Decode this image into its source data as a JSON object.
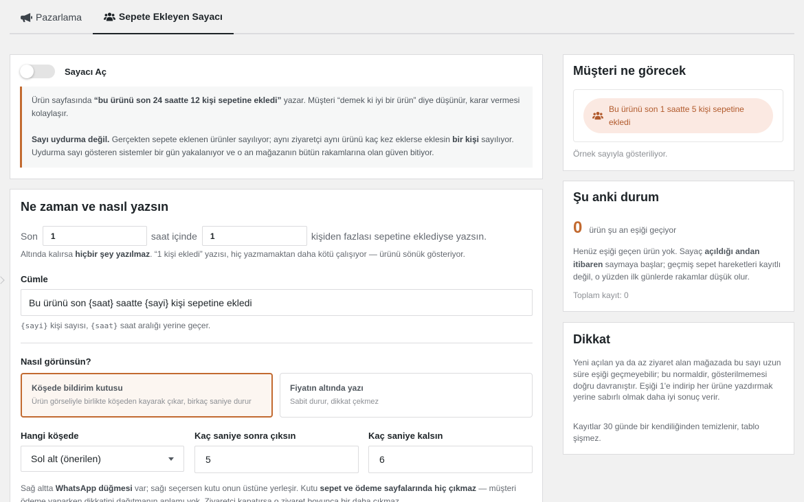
{
  "tabs": [
    {
      "label": "Pazarlama",
      "icon": "bullhorn-icon",
      "active": false
    },
    {
      "label": "Sepete Ekleyen Sayacı",
      "icon": "users-icon",
      "active": true
    }
  ],
  "toggle_card": {
    "toggle_label": "Sayacı Aç",
    "toggle_on": false,
    "info": {
      "p1_a": "Ürün sayfasında ",
      "p1_b": "“bu ürünü son 24 saatte 12 kişi sepetine ekledi”",
      "p1_c": " yazar. Müşteri “demek ki iyi bir ürün” diye düşünür, karar vermesi kolaylaşır.",
      "p2_a": "Sayı uydurma değil.",
      "p2_b": " Gerçekten sepete eklenen ürünler sayılıyor; aynı ziyaretçi aynı ürünü kaç kez eklerse eklesin ",
      "p2_c": "bir kişi",
      "p2_d": " sayılıyor. Uydurma sayı gösteren sistemler bir gün yakalanıyor ve o an mağazanın bütün rakamlarına olan güven bitiyor."
    }
  },
  "config": {
    "title": "Ne zaman ve nasıl yazsın",
    "son_label": "Son",
    "hours_value": "1",
    "hours_suffix": "saat içinde",
    "people_value": "1",
    "people_suffix": "kişiden fazlası sepetine eklediyse yazsın.",
    "hint_a": "Altında kalırsa ",
    "hint_b": "hiçbir şey yazılmaz",
    "hint_c": ". “1 kişi ekledi” yazısı, hiç yazmamaktan daha kötü çalışıyor — ürünü sönük gösteriyor.",
    "sentence_label": "Cümle",
    "sentence_value": "Bu ürünü son {saat} saatte {sayi} kişi sepetine ekledi",
    "ph_code1": "{sayi}",
    "ph_text1": " kişi sayısı, ",
    "ph_code2": "{saat}",
    "ph_text2": " saat aralığı yerine geçer.",
    "display_label": "Nasıl görünsün?",
    "options": [
      {
        "title": "Köşede bildirim kutusu",
        "subtitle": "Ürün görseliyle birlikte köşeden kayarak çıkar, birkaç saniye durur",
        "selected": true
      },
      {
        "title": "Fiyatın altında yazı",
        "subtitle": "Sabit durur, dikkat çekmez",
        "selected": false
      }
    ],
    "corner_label": "Hangi köşede",
    "corner_value": "Sol alt (önerilen)",
    "delay_label": "Kaç saniye sonra çıksın",
    "delay_value": "5",
    "duration_label": "Kaç saniye kalsın",
    "duration_value": "6",
    "footer_a": "Sağ altta ",
    "footer_b": "WhatsApp düğmesi",
    "footer_c": " var; sağı seçersen kutu onun üstüne yerleşir. Kutu ",
    "footer_d": "sepet ve ödeme sayfalarında hiç çıkmaz",
    "footer_e": " — müşteri ödeme yaparken dikkatini dağıtmanın anlamı yok. Ziyaretçi kapatırsa o ziyaret boyunca bir daha çıkmaz."
  },
  "preview": {
    "title": "Müşteri ne görecek",
    "pill_text": "Bu ürünü son 1 saatte 5 kişi sepetine ekledi",
    "caption": "Örnek sayıyla gösteriliyor."
  },
  "status": {
    "title": "Şu anki durum",
    "count": "0",
    "count_label": "ürün şu an eşiği geçiyor",
    "desc_a": "Henüz eşiği geçen ürün yok. Sayaç ",
    "desc_b": "açıldığı andan itibaren",
    "desc_c": " saymaya başlar; geçmiş sepet hareketleri kayıtlı değil, o yüzden ilk günlerde rakamlar düşük olur.",
    "total": "Toplam kayıt: 0"
  },
  "warning": {
    "title": "Dikkat",
    "p1": "Yeni açılan ya da az ziyaret alan mağazada bu sayı uzun süre eşiği geçmeyebilir; bu normaldir, gösterilmemesi doğru davranıştır. Eşiği 1'e indirip her ürüne yazdırmak yerine sabırlı olmak daha iyi sonuç verir.",
    "p2": "Kayıtlar 30 günde bir kendiliğinden temizlenir, tablo şişmez."
  },
  "colors": {
    "accent": "#c26a30",
    "count": "#c26a30",
    "pill_bg": "#fbe9e2"
  }
}
